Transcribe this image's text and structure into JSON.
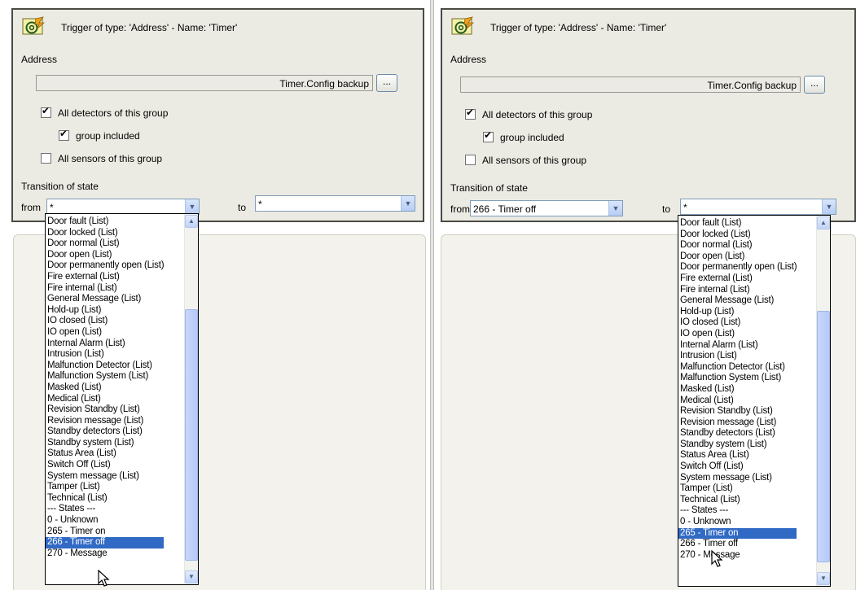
{
  "panels": [
    {
      "trigger_title": "Trigger of type: 'Address'  -  Name: 'Timer'",
      "address_label": "Address",
      "address_value": "Timer.Config backup",
      "browse_label": "...",
      "all_detectors_label": "All detectors of this group",
      "all_detectors_checked": true,
      "group_included_label": "group included",
      "group_included_checked": true,
      "all_sensors_label": "All sensors of this group",
      "all_sensors_checked": false,
      "transition_label": "Transition of state",
      "from_label": "from",
      "from_value": "*",
      "to_label": "to",
      "to_value": "*",
      "open_dropdown": "from",
      "selected_item": "266 - Timer off"
    },
    {
      "trigger_title": "Trigger of type: 'Address'  -  Name: 'Timer'",
      "address_label": "Address",
      "address_value": "Timer.Config backup",
      "browse_label": "...",
      "all_detectors_label": "All detectors of this group",
      "all_detectors_checked": true,
      "group_included_label": "group included",
      "group_included_checked": true,
      "all_sensors_label": "All sensors of this group",
      "all_sensors_checked": false,
      "transition_label": "Transition of state",
      "from_label": "from",
      "from_value": "266 - Timer off",
      "to_label": "to",
      "to_value": "*",
      "open_dropdown": "to",
      "selected_item": "265 - Timer on"
    }
  ],
  "dropdown_items": [
    "Door fault (List)",
    "Door locked (List)",
    "Door normal (List)",
    "Door open (List)",
    "Door permanently open (List)",
    "Fire external (List)",
    "Fire internal (List)",
    "General Message (List)",
    "Hold-up (List)",
    "IO closed (List)",
    "IO open (List)",
    "Internal Alarm (List)",
    "Intrusion (List)",
    "Malfunction Detector (List)",
    "Malfunction System (List)",
    "Masked (List)",
    "Medical (List)",
    "Revision Standby (List)",
    "Revision message (List)",
    "Standby detectors (List)",
    "Standby system (List)",
    "Status Area (List)",
    "Switch Off (List)",
    "System message (List)",
    "Tamper (List)",
    "Technical (List)",
    "--- States ---",
    "0 - Unknown",
    "265 - Timer on",
    "266 - Timer off",
    "270 - Message"
  ],
  "icons": {
    "trigger": "address-trigger-icon",
    "checkbox_mark": "✔",
    "combo_arrow": "chevron-down-icon",
    "scroll_up": "scroll-up-arrow-icon",
    "scroll_down": "scroll-down-arrow-icon",
    "pointer": "mouse-pointer-icon"
  },
  "colors": {
    "selection": "#316ac5",
    "panel_bg": "#ecebe3",
    "panel_border": "#4a4a44"
  }
}
